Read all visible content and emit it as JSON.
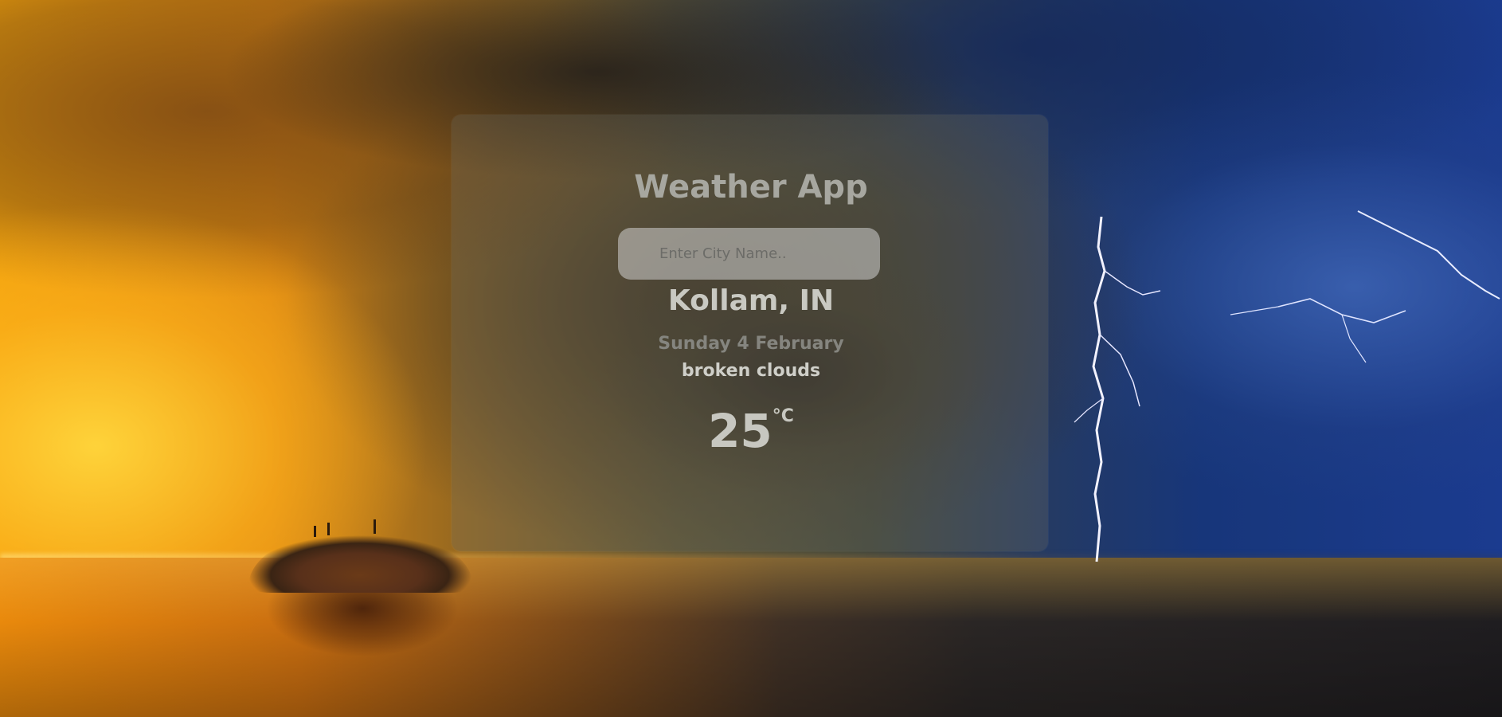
{
  "app": {
    "title": "Weather App"
  },
  "search": {
    "placeholder": "Enter City Name..",
    "value": ""
  },
  "weather": {
    "location": "Kollam, IN",
    "date": "Sunday 4 February",
    "condition": "broken clouds",
    "temperature": "25",
    "unit": "°C"
  },
  "background": {
    "scene": "sunset-and-storm-seascape",
    "colors": {
      "sunset": "#f2a20d",
      "storm": "#1b3b8f",
      "card": "#6e6e64"
    }
  }
}
